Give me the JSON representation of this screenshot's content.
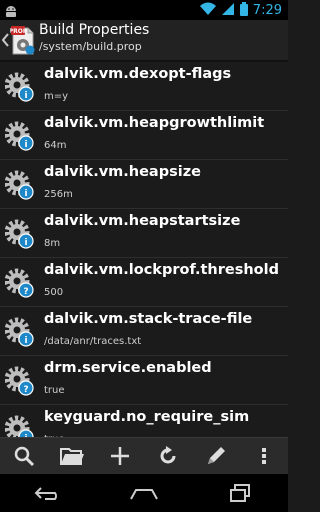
{
  "status_bar": {
    "time": "7:29",
    "icons": [
      "android-icon",
      "wifi-icon",
      "signal-icon",
      "battery-icon"
    ]
  },
  "action_bar": {
    "title": "Build Properties",
    "subtitle": "/system/build.prop",
    "app_icon": "build-prop-app-icon"
  },
  "properties": [
    {
      "name": "dalvik.vm.dexopt-flags",
      "value": "m=y",
      "badge": "info"
    },
    {
      "name": "dalvik.vm.heapgrowthlimit",
      "value": "64m",
      "badge": "info"
    },
    {
      "name": "dalvik.vm.heapsize",
      "value": "256m",
      "badge": "info"
    },
    {
      "name": "dalvik.vm.heapstartsize",
      "value": "8m",
      "badge": "info"
    },
    {
      "name": "dalvik.vm.lockprof.threshold",
      "value": "500",
      "badge": "question"
    },
    {
      "name": "dalvik.vm.stack-trace-file",
      "value": "/data/anr/traces.txt",
      "badge": "info"
    },
    {
      "name": "drm.service.enabled",
      "value": "true",
      "badge": "question"
    },
    {
      "name": "keyguard.no_require_sim",
      "value": "true",
      "badge": "info"
    }
  ],
  "toolbar": [
    "search-icon",
    "folder-icon",
    "add-icon",
    "refresh-icon",
    "edit-icon",
    "overflow-menu-icon"
  ],
  "nav_bar": [
    "back-icon",
    "home-icon",
    "recent-apps-icon"
  ],
  "colors": {
    "accent": "#33b5e5",
    "info_badge": "#1e88c8",
    "background": "#1b1b1b"
  }
}
